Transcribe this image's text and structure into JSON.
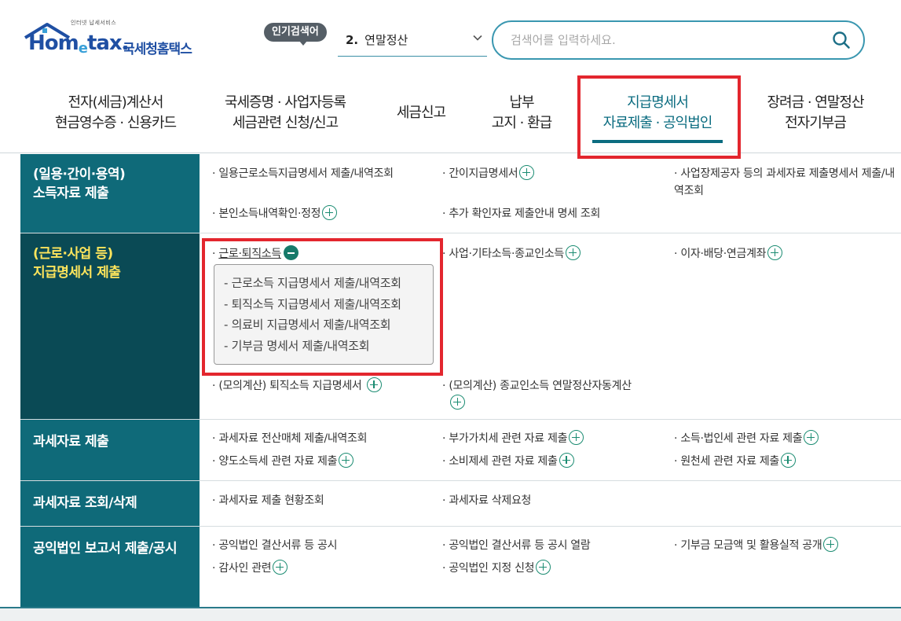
{
  "header": {
    "logo_small": "인터넷 납세서비스",
    "logo_brand_a": "Hom",
    "logo_brand_e": "e",
    "logo_brand_b": "tax.",
    "logo_korean": "국세청홈택스",
    "popular_badge": "인기검색어",
    "popular_rank": "2.",
    "popular_term": "연말정산",
    "search_placeholder": "검색어를 입력하세요."
  },
  "gnb": {
    "items": [
      {
        "line1": "전자(세금)계산서",
        "line2": "현금영수증 · 신용카드"
      },
      {
        "line1": "국세증명 · 사업자등록",
        "line2": "세금관련 신청/신고"
      },
      {
        "line1": "세금신고",
        "line2": ""
      },
      {
        "line1": "납부",
        "line2": "고지 · 환급"
      },
      {
        "line1": "지급명세서",
        "line2": "자료제출 · 공익법인"
      },
      {
        "line1": "장려금 · 연말정산",
        "line2": "전자기부금"
      }
    ]
  },
  "menu": {
    "cat1": {
      "line1": "(일용·간이·용역)",
      "line2": "소득자료 제출"
    },
    "cat1_links": [
      "일용근로소득지급명세서 제출/내역조회",
      "간이지급명세서",
      "사업장제공자 등의 과세자료 제출명세서 제출/내역조회",
      "본인소득내역확인·정정",
      "추가 확인자료 제출안내 명세 조회"
    ],
    "cat2": {
      "line1": "(근로·사업 등)",
      "line2": "지급명세서 제출"
    },
    "cat2_links": [
      "근로·퇴직소득",
      "사업·기타소득·종교인소득",
      "이자·배당·연금계좌",
      "(모의계산) 퇴직소득 지급명세서",
      "(모의계산) 종교인소득 연말정산자동계산"
    ],
    "cat2_sub": [
      "- 근로소득 지급명세서 제출/내역조회",
      "- 퇴직소득 지급명세서 제출/내역조회",
      "- 의료비 지급명세서 제출/내역조회",
      "- 기부금 명세서 제출/내역조회"
    ],
    "cat3": {
      "line1": "과세자료 제출"
    },
    "cat3_links": [
      "과세자료 전산매체 제출/내역조회",
      "부가가치세 관련 자료 제출",
      "소득·법인세 관련 자료 제출",
      "양도소득세 관련 자료 제출",
      "소비제세 관련 자료 제출",
      "원천세 관련 자료 제출"
    ],
    "cat4": {
      "line1": "과세자료 조회/삭제"
    },
    "cat4_links": [
      "과세자료 제출 현황조회",
      "과세자료 삭제요청"
    ],
    "cat5": {
      "line1": "공익법인 보고서 제출/공시"
    },
    "cat5_links": [
      "공익법인 결산서류 등 공시",
      "공익법인 결산서류 등 공시 열람",
      "기부금 모금액 및 활용실적 공개",
      "감사인 관련",
      "공익법인 지정 신청"
    ]
  },
  "colors": {
    "accent": "#0f6a79",
    "highlight": "#ffe55c",
    "outline": "#e3262e",
    "plus": "#1b8c72"
  }
}
